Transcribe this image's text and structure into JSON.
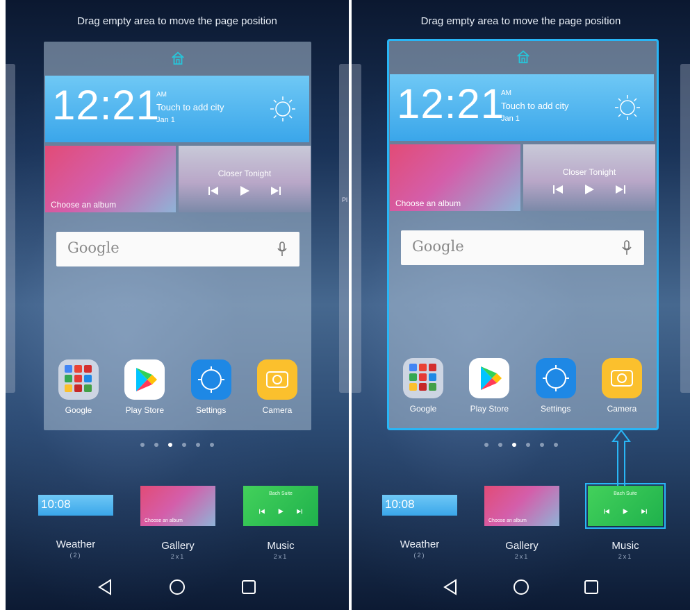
{
  "screens": [
    {
      "hint": "Drag empty area to move the page position",
      "side_label": "",
      "weather": {
        "time": "12:21",
        "ampm": "AM",
        "city": "Touch to add city",
        "date": "Jan 1"
      },
      "gallery": {
        "label": "Choose an album"
      },
      "music": {
        "title": "Closer Tonight"
      },
      "search": {
        "placeholder": "Google"
      },
      "apps": [
        {
          "label": "Google"
        },
        {
          "label": "Play Store"
        },
        {
          "label": "Settings"
        },
        {
          "label": "Camera"
        }
      ],
      "page_count": 6,
      "active_page": 2,
      "tray": [
        {
          "label": "Weather",
          "sub": "(2)",
          "thumb_text": "10:08"
        },
        {
          "label": "Gallery",
          "sub": "2x1",
          "thumb_text": "Choose an album"
        },
        {
          "label": "Music",
          "sub": "2x1",
          "thumb_text": "Bach Suite"
        }
      ]
    },
    {
      "hint": "Drag empty area to move the page position",
      "side_label": "Pl",
      "weather": {
        "time": "12:21",
        "ampm": "AM",
        "city": "Touch to add city",
        "date": "Jan 1"
      },
      "gallery": {
        "label": "Choose an album"
      },
      "music": {
        "title": "Closer Tonight"
      },
      "search": {
        "placeholder": "Google"
      },
      "apps": [
        {
          "label": "Google"
        },
        {
          "label": "Play Store"
        },
        {
          "label": "Settings"
        },
        {
          "label": "Camera"
        }
      ],
      "page_count": 6,
      "active_page": 2,
      "tray": [
        {
          "label": "Weather",
          "sub": "(2)",
          "thumb_text": "10:08"
        },
        {
          "label": "Gallery",
          "sub": "2x1",
          "thumb_text": "Choose an album"
        },
        {
          "label": "Music",
          "sub": "2x1",
          "thumb_text": "Bach Suite"
        }
      ]
    }
  ],
  "colors": {
    "accent": "#29b6f6",
    "weather": "#3aa6ea",
    "music_thumb": "#1fb14c",
    "camera": "#fbc02d",
    "settings": "#1e88e5"
  },
  "icons": [
    "home-icon",
    "sun-icon",
    "mic-icon",
    "folder-icon",
    "play-store-icon",
    "settings-icon",
    "camera-icon",
    "back-icon",
    "home-nav-icon",
    "recents-icon",
    "arrow-up-icon"
  ]
}
